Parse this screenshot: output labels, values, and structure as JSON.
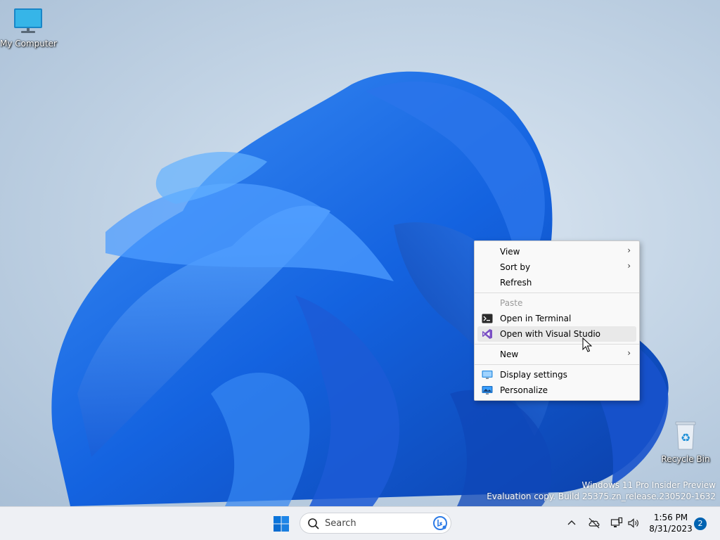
{
  "desktop": {
    "icons": [
      {
        "label": "My Computer",
        "icon": "monitor-icon"
      },
      {
        "label": "Recycle Bin",
        "icon": "recycle-bin-icon"
      }
    ],
    "watermark": {
      "line1": "Windows 11 Pro Insider Preview",
      "line2": "Evaluation copy. Build 25375.zn_release.230520-1632"
    }
  },
  "context_menu": {
    "items": [
      {
        "label": "View",
        "submenu": true
      },
      {
        "label": "Sort by",
        "submenu": true
      },
      {
        "label": "Refresh"
      },
      {
        "label": "Paste",
        "disabled": true
      },
      {
        "label": "Open in Terminal",
        "icon": "terminal-icon"
      },
      {
        "label": "Open with Visual Studio",
        "icon": "visual-studio-icon",
        "hover": true
      },
      {
        "label": "New",
        "submenu": true
      },
      {
        "label": "Display settings",
        "icon": "display-icon"
      },
      {
        "label": "Personalize",
        "icon": "personalize-icon"
      }
    ],
    "chevron": "›"
  },
  "taskbar": {
    "search_placeholder": "Search",
    "time": "1:56 PM",
    "date": "8/31/2023",
    "notification_count": "2",
    "accent": "#0063b1"
  }
}
